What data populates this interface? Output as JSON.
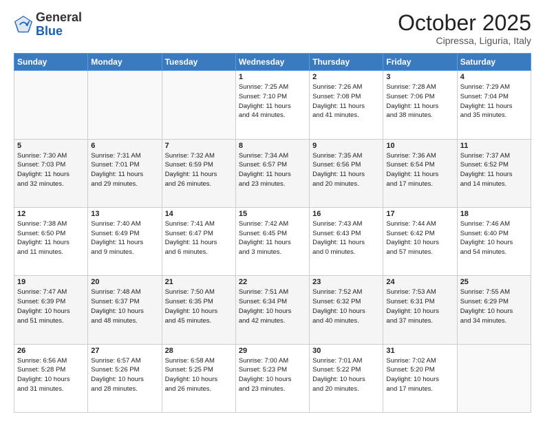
{
  "header": {
    "logo_general": "General",
    "logo_blue": "Blue",
    "month_title": "October 2025",
    "location": "Cipressa, Liguria, Italy"
  },
  "days_of_week": [
    "Sunday",
    "Monday",
    "Tuesday",
    "Wednesday",
    "Thursday",
    "Friday",
    "Saturday"
  ],
  "weeks": [
    [
      {
        "day": "",
        "info": ""
      },
      {
        "day": "",
        "info": ""
      },
      {
        "day": "",
        "info": ""
      },
      {
        "day": "1",
        "info": "Sunrise: 7:25 AM\nSunset: 7:10 PM\nDaylight: 11 hours\nand 44 minutes."
      },
      {
        "day": "2",
        "info": "Sunrise: 7:26 AM\nSunset: 7:08 PM\nDaylight: 11 hours\nand 41 minutes."
      },
      {
        "day": "3",
        "info": "Sunrise: 7:28 AM\nSunset: 7:06 PM\nDaylight: 11 hours\nand 38 minutes."
      },
      {
        "day": "4",
        "info": "Sunrise: 7:29 AM\nSunset: 7:04 PM\nDaylight: 11 hours\nand 35 minutes."
      }
    ],
    [
      {
        "day": "5",
        "info": "Sunrise: 7:30 AM\nSunset: 7:03 PM\nDaylight: 11 hours\nand 32 minutes."
      },
      {
        "day": "6",
        "info": "Sunrise: 7:31 AM\nSunset: 7:01 PM\nDaylight: 11 hours\nand 29 minutes."
      },
      {
        "day": "7",
        "info": "Sunrise: 7:32 AM\nSunset: 6:59 PM\nDaylight: 11 hours\nand 26 minutes."
      },
      {
        "day": "8",
        "info": "Sunrise: 7:34 AM\nSunset: 6:57 PM\nDaylight: 11 hours\nand 23 minutes."
      },
      {
        "day": "9",
        "info": "Sunrise: 7:35 AM\nSunset: 6:56 PM\nDaylight: 11 hours\nand 20 minutes."
      },
      {
        "day": "10",
        "info": "Sunrise: 7:36 AM\nSunset: 6:54 PM\nDaylight: 11 hours\nand 17 minutes."
      },
      {
        "day": "11",
        "info": "Sunrise: 7:37 AM\nSunset: 6:52 PM\nDaylight: 11 hours\nand 14 minutes."
      }
    ],
    [
      {
        "day": "12",
        "info": "Sunrise: 7:38 AM\nSunset: 6:50 PM\nDaylight: 11 hours\nand 11 minutes."
      },
      {
        "day": "13",
        "info": "Sunrise: 7:40 AM\nSunset: 6:49 PM\nDaylight: 11 hours\nand 9 minutes."
      },
      {
        "day": "14",
        "info": "Sunrise: 7:41 AM\nSunset: 6:47 PM\nDaylight: 11 hours\nand 6 minutes."
      },
      {
        "day": "15",
        "info": "Sunrise: 7:42 AM\nSunset: 6:45 PM\nDaylight: 11 hours\nand 3 minutes."
      },
      {
        "day": "16",
        "info": "Sunrise: 7:43 AM\nSunset: 6:43 PM\nDaylight: 11 hours\nand 0 minutes."
      },
      {
        "day": "17",
        "info": "Sunrise: 7:44 AM\nSunset: 6:42 PM\nDaylight: 10 hours\nand 57 minutes."
      },
      {
        "day": "18",
        "info": "Sunrise: 7:46 AM\nSunset: 6:40 PM\nDaylight: 10 hours\nand 54 minutes."
      }
    ],
    [
      {
        "day": "19",
        "info": "Sunrise: 7:47 AM\nSunset: 6:39 PM\nDaylight: 10 hours\nand 51 minutes."
      },
      {
        "day": "20",
        "info": "Sunrise: 7:48 AM\nSunset: 6:37 PM\nDaylight: 10 hours\nand 48 minutes."
      },
      {
        "day": "21",
        "info": "Sunrise: 7:50 AM\nSunset: 6:35 PM\nDaylight: 10 hours\nand 45 minutes."
      },
      {
        "day": "22",
        "info": "Sunrise: 7:51 AM\nSunset: 6:34 PM\nDaylight: 10 hours\nand 42 minutes."
      },
      {
        "day": "23",
        "info": "Sunrise: 7:52 AM\nSunset: 6:32 PM\nDaylight: 10 hours\nand 40 minutes."
      },
      {
        "day": "24",
        "info": "Sunrise: 7:53 AM\nSunset: 6:31 PM\nDaylight: 10 hours\nand 37 minutes."
      },
      {
        "day": "25",
        "info": "Sunrise: 7:55 AM\nSunset: 6:29 PM\nDaylight: 10 hours\nand 34 minutes."
      }
    ],
    [
      {
        "day": "26",
        "info": "Sunrise: 6:56 AM\nSunset: 5:28 PM\nDaylight: 10 hours\nand 31 minutes."
      },
      {
        "day": "27",
        "info": "Sunrise: 6:57 AM\nSunset: 5:26 PM\nDaylight: 10 hours\nand 28 minutes."
      },
      {
        "day": "28",
        "info": "Sunrise: 6:58 AM\nSunset: 5:25 PM\nDaylight: 10 hours\nand 26 minutes."
      },
      {
        "day": "29",
        "info": "Sunrise: 7:00 AM\nSunset: 5:23 PM\nDaylight: 10 hours\nand 23 minutes."
      },
      {
        "day": "30",
        "info": "Sunrise: 7:01 AM\nSunset: 5:22 PM\nDaylight: 10 hours\nand 20 minutes."
      },
      {
        "day": "31",
        "info": "Sunrise: 7:02 AM\nSunset: 5:20 PM\nDaylight: 10 hours\nand 17 minutes."
      },
      {
        "day": "",
        "info": ""
      }
    ]
  ]
}
